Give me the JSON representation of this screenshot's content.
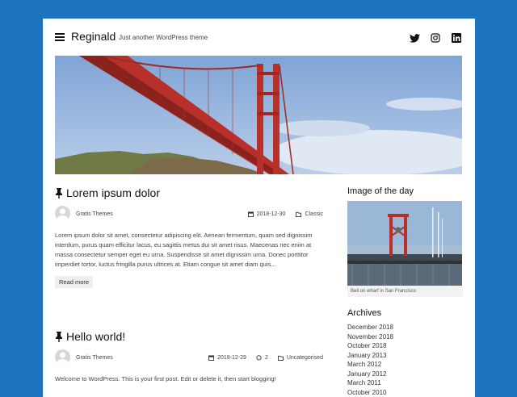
{
  "site": {
    "title": "Reginald",
    "tagline": "Just another WordPress theme"
  },
  "social": [
    "twitter-icon",
    "instagram-icon",
    "linkedin-icon"
  ],
  "posts": [
    {
      "title": "Lorem ipsum dolor",
      "author": "Gratis Themes",
      "date": "2018-12-30",
      "category": "Classic",
      "excerpt": "Lorem ipsum dolor sit amet, consectetur adipiscing elit. Aenean fermentum, quam sed dignissim interdum, purus quam efficitur lacus, eu sagittis metus dui sit amet risus. Maecenas nec enim at massa consectetur semper eget eu urna. Suspendisse sit amet dignissim urna. Donec porttitor imperdiet tortor, luctus fringilla purus ultrices at. Etiam congue sit amet diam quis...",
      "read_more": "Read more"
    },
    {
      "title": "Hello world!",
      "author": "Gratis Themes",
      "date": "2018-12-29",
      "comments": "2",
      "category": "Uncategorised",
      "excerpt": "Welcome to WordPress. This is your first post. Edit or delete it, then start blogging!"
    }
  ],
  "sidebar": {
    "image_widget_title": "Image of the day",
    "image_caption": "Bell on wharf in San Francisco",
    "archives_title": "Archives",
    "archives": [
      "December 2018",
      "November 2018",
      "October 2018",
      "January 2013",
      "March 2012",
      "January 2012",
      "March 2011",
      "October 2010"
    ]
  },
  "colors": {
    "background": "#1e73be",
    "page": "#ffffff",
    "bridge": "#b8302a"
  }
}
